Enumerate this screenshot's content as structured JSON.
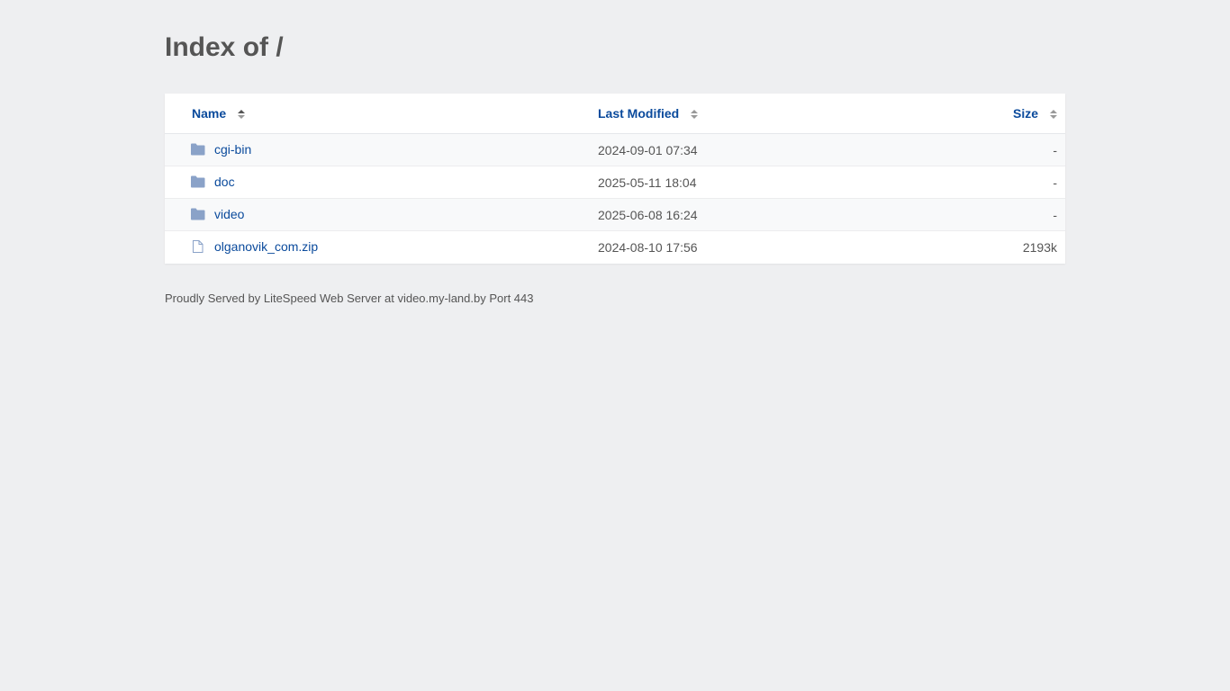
{
  "page": {
    "title": "Index of /"
  },
  "table": {
    "headers": {
      "name": "Name",
      "last_modified": "Last Modified",
      "size": "Size"
    },
    "rows": [
      {
        "icon": "folder-icon",
        "name": "cgi-bin",
        "modified": "2024-09-01 07:34",
        "size": "-"
      },
      {
        "icon": "folder-icon",
        "name": "doc",
        "modified": "2025-05-11 18:04",
        "size": "-"
      },
      {
        "icon": "folder-icon",
        "name": "video",
        "modified": "2025-06-08 16:24",
        "size": "-"
      },
      {
        "icon": "file-icon",
        "name": "olganovik_com.zip",
        "modified": "2024-08-10 17:56",
        "size": "2193k"
      }
    ]
  },
  "footer": {
    "text": "Proudly Served by LiteSpeed Web Server at video.my-land.by Port 443"
  },
  "colors": {
    "background": "#eeeff1",
    "link": "#0a4a9c",
    "folder_icon": "#8aa2c8",
    "text": "#555555"
  }
}
